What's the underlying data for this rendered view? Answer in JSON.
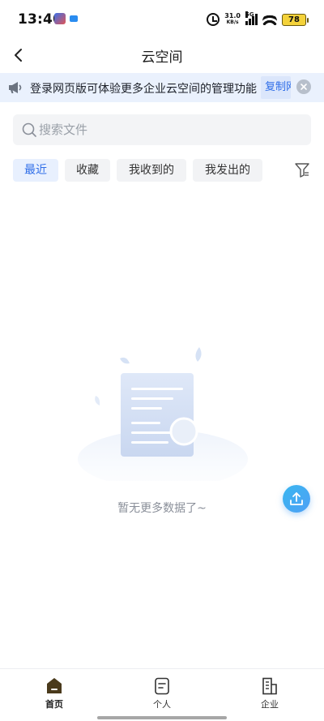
{
  "status_bar": {
    "time": "13:40",
    "net_speed_value": "31.0",
    "net_speed_unit": "KB/s",
    "network_type": "5G",
    "battery": "78"
  },
  "header": {
    "title": "云空间"
  },
  "banner": {
    "text": "登录网页版可体验更多企业云空间的管理功能",
    "link_label": "复制网址"
  },
  "search": {
    "placeholder": "搜索文件"
  },
  "tabs": [
    {
      "label": "最近",
      "active": true
    },
    {
      "label": "收藏",
      "active": false
    },
    {
      "label": "我收到的",
      "active": false
    },
    {
      "label": "我发出的",
      "active": false
    }
  ],
  "empty_state": {
    "message": "暂无更多数据了~"
  },
  "bottom_nav": {
    "items": [
      {
        "label": "首页",
        "icon": "home-icon",
        "active": true
      },
      {
        "label": "个人",
        "icon": "note-icon",
        "active": false
      },
      {
        "label": "企业",
        "icon": "building-icon",
        "active": false
      }
    ]
  },
  "colors": {
    "accent": "#2f6ee8",
    "banner_bg": "#eaf1fd",
    "fab": "#3ab0f2"
  }
}
